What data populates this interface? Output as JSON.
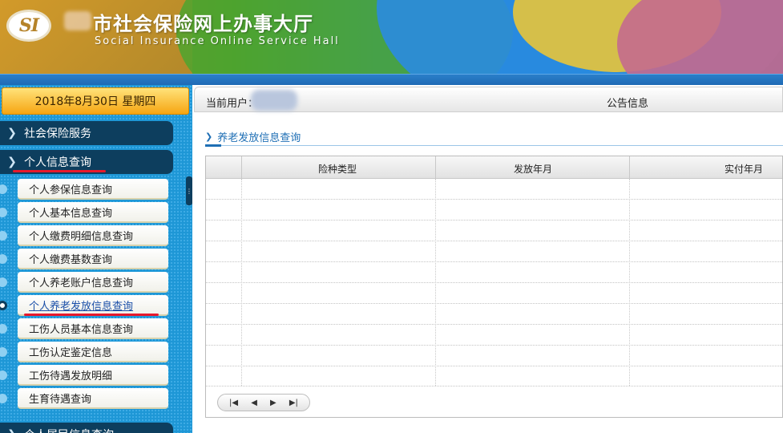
{
  "header": {
    "logo_text": "SI",
    "title": "市社会保险网上办事大厅",
    "subtitle": "Social Insurance Online Service Hall"
  },
  "sidebar": {
    "date": "2018年8月30日 星期四",
    "groups": [
      {
        "label": "社会保险服务"
      },
      {
        "label": "个人信息查询"
      },
      {
        "label": "个人居民信息查询"
      }
    ],
    "items": [
      {
        "label": "个人参保信息查询"
      },
      {
        "label": "个人基本信息查询"
      },
      {
        "label": "个人缴费明细信息查询"
      },
      {
        "label": "个人缴费基数查询"
      },
      {
        "label": "个人养老账户信息查询"
      },
      {
        "label": "个人养老发放信息查询",
        "active": true
      },
      {
        "label": "工伤人员基本信息查询"
      },
      {
        "label": "工伤认定鉴定信息"
      },
      {
        "label": "工伤待遇发放明细"
      },
      {
        "label": "生育待遇查询"
      }
    ]
  },
  "userbar": {
    "user_label": "当前用户：",
    "notice_label": "公告信息"
  },
  "page": {
    "heading": "养老发放信息查询"
  },
  "grid": {
    "columns": [
      "险种类型",
      "发放年月",
      "实付年月"
    ],
    "rows": []
  },
  "pager": {
    "first": "first-page-icon",
    "prev": "prev-page-icon",
    "next": "next-page-icon",
    "last": "last-page-icon"
  },
  "colors": {
    "sidebar": "#1e97d6",
    "nav_group": "#0d3e5e",
    "date_box": "#f6a512",
    "link_active": "#1b4fa8",
    "annotation": "#e8192c"
  }
}
